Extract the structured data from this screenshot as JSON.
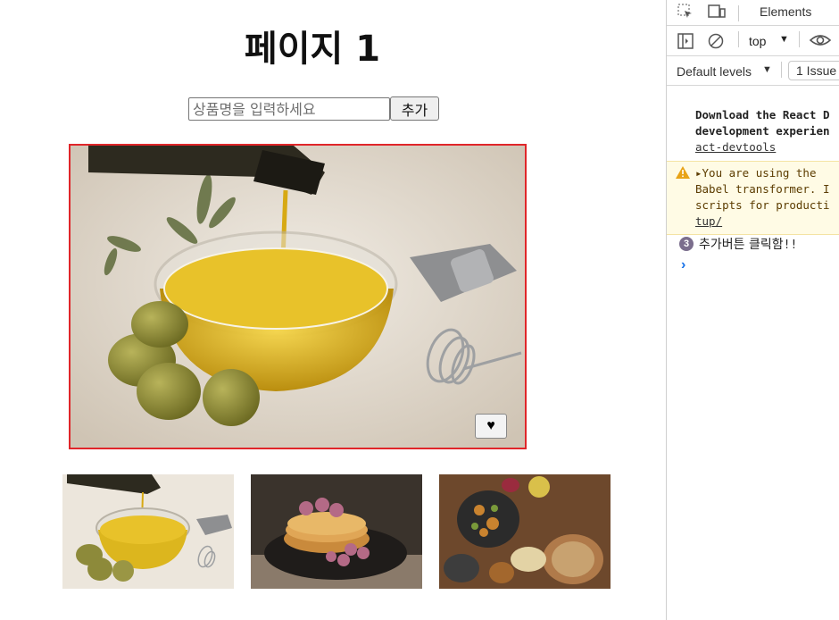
{
  "page": {
    "title": "페이지 1",
    "input_placeholder": "상품명을 입력하세요",
    "add_button": "추가",
    "like_button": "♥"
  },
  "devtools": {
    "tab_elements": "Elements",
    "context": "top",
    "levels": "Default levels",
    "issues": "1 Issue",
    "console": {
      "msg1_lines": [
        "Download the React D",
        "development experien"
      ],
      "msg1_link": "act-devtools",
      "warn_lines": [
        "You are using the",
        "Babel transformer. I",
        "scripts for producti"
      ],
      "warn_link": "tup/",
      "log_count": "3",
      "log_text": "추가버튼 클릭함",
      "log_suffix": "!!",
      "prompt": "›"
    }
  },
  "colors": {
    "image_border": "#e0262a",
    "log_badge": "#7b6e8d",
    "warn_bg": "#fffbe5",
    "prompt": "#1a73e8"
  }
}
